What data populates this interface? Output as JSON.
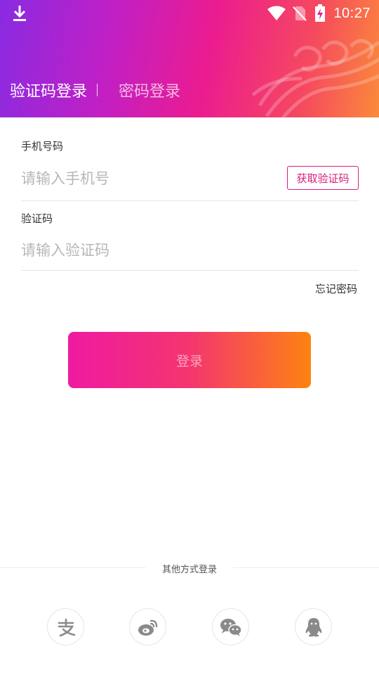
{
  "status_bar": {
    "time": "10:27",
    "icons": [
      "download-icon",
      "wifi-icon",
      "no-sim-icon",
      "battery-charging-icon"
    ]
  },
  "tabs": [
    {
      "label": "验证码登录",
      "active": true
    },
    {
      "label": "密码登录",
      "active": false
    }
  ],
  "phone": {
    "label": "手机号码",
    "placeholder": "请输入手机号",
    "value": ""
  },
  "get_code_button": "获取验证码",
  "code": {
    "label": "验证码",
    "placeholder": "请输入验证码",
    "value": ""
  },
  "forgot_password": "忘记密码",
  "login_button": "登录",
  "other_login": {
    "title": "其他方式登录",
    "methods": [
      "alipay-icon",
      "weibo-icon",
      "wechat-icon",
      "qq-icon"
    ]
  },
  "colors": {
    "accent": "#d81d7e",
    "gradient_start": "#ef1aa0",
    "gradient_end": "#fd8311",
    "header_start": "#8a2be2"
  }
}
